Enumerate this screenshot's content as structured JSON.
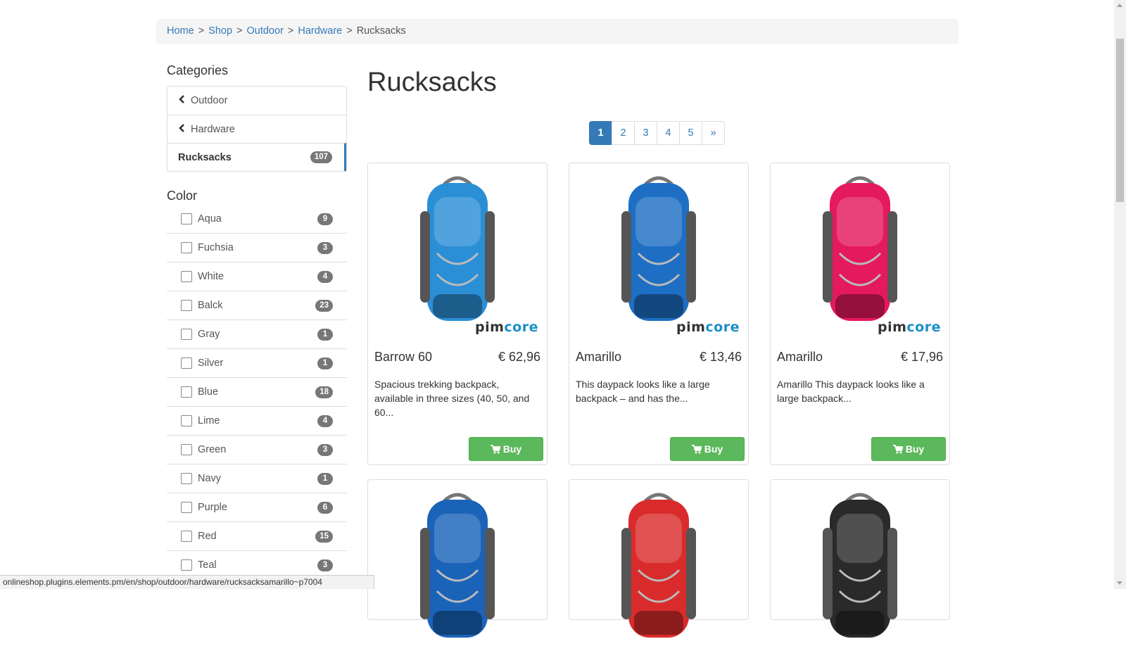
{
  "breadcrumb": {
    "items": [
      "Home",
      "Shop",
      "Outdoor",
      "Hardware"
    ],
    "separator": ">",
    "current": "Rucksacks"
  },
  "sidebar": {
    "categories_title": "Categories",
    "categories": [
      {
        "label": "Outdoor",
        "icon": "chevron-left-icon"
      },
      {
        "label": "Hardware",
        "icon": "chevron-left-icon"
      },
      {
        "label": "Rucksacks",
        "count": "107",
        "active": true
      }
    ],
    "color_title": "Color",
    "colors": [
      {
        "label": "Aqua",
        "count": "9"
      },
      {
        "label": "Fuchsia",
        "count": "3"
      },
      {
        "label": "White",
        "count": "4"
      },
      {
        "label": "Balck",
        "count": "23"
      },
      {
        "label": "Gray",
        "count": "1"
      },
      {
        "label": "Silver",
        "count": "1"
      },
      {
        "label": "Blue",
        "count": "18"
      },
      {
        "label": "Lime",
        "count": "4"
      },
      {
        "label": "Green",
        "count": "3"
      },
      {
        "label": "Navy",
        "count": "1"
      },
      {
        "label": "Purple",
        "count": "6"
      },
      {
        "label": "Red",
        "count": "15"
      },
      {
        "label": "Teal",
        "count": "3"
      }
    ]
  },
  "main": {
    "title": "Rucksacks",
    "pagination": [
      "1",
      "2",
      "3",
      "4",
      "5",
      "»"
    ],
    "active_page": "1",
    "buy_label": "Buy",
    "logo": {
      "pim": "pim",
      "core": "core"
    },
    "products": [
      {
        "name": "Barrow 60",
        "price": "€ 62,96",
        "desc": "Spacious trekking backpack, available in three sizes (40, 50, and 60...",
        "color": "#2b8fd6"
      },
      {
        "name": "Amarillo",
        "price": "€ 13,46",
        "desc": "This daypack looks like a large backpack – and has the...",
        "color": "#1e6fc4"
      },
      {
        "name": "Amarillo",
        "price": "€ 17,96",
        "desc": "Amarillo   This daypack looks like a large backpack...",
        "color": "#e5195e"
      },
      {
        "color": "#1a63b8"
      },
      {
        "color": "#d92b2b"
      },
      {
        "color": "#2a2a2a"
      }
    ]
  },
  "statusbar": "onlineshop.plugins.elements.pm/en/shop/outdoor/hardware/rucksacksamarillo~p7004",
  "colors": {
    "link": "#337ab7",
    "buy": "#5cb85c",
    "badge": "#777777"
  }
}
